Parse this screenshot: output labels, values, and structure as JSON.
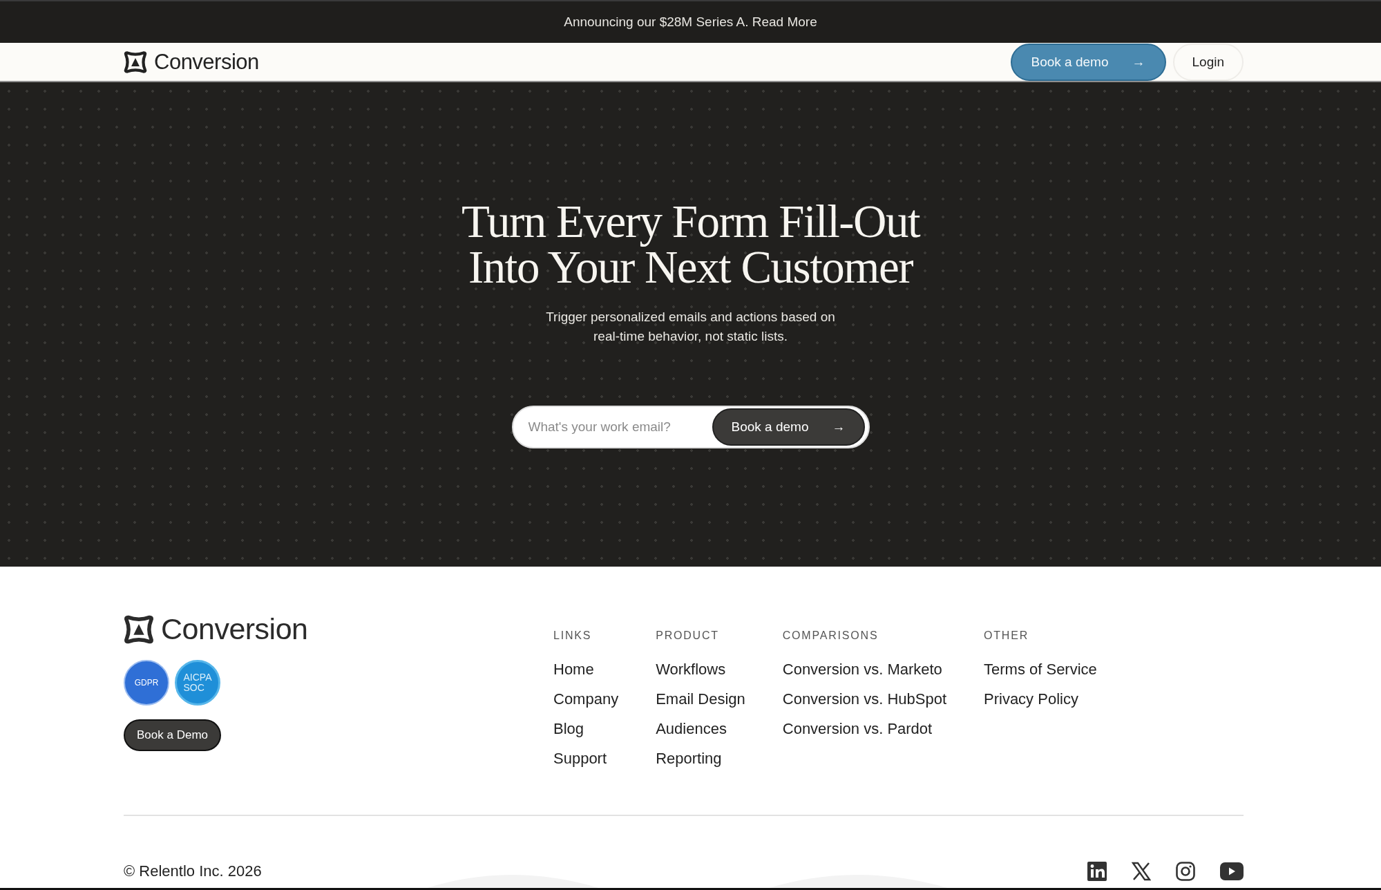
{
  "announcement": "Announcing our $28M Series A. Read More",
  "nav": {
    "brand": "Conversion",
    "buttons": [
      {
        "label": "Book a demo",
        "kind": "primary",
        "arrow": "→"
      },
      {
        "label": "Login",
        "kind": "outline"
      }
    ]
  },
  "hero": {
    "title_lines": [
      "Turn Every Form Fill-Out",
      "Into Your Next Customer"
    ],
    "subtitle_lines": [
      "Trigger personalized emails and actions based on",
      "real-time behavior, not static lists."
    ],
    "email": {
      "placeholder": "What's your work email?"
    },
    "button": {
      "label": "Book a demo",
      "arrow": "→"
    }
  },
  "footer": {
    "brand": "Conversion",
    "badges": [
      {
        "lines": [
          "GDPR"
        ],
        "kind": "gdpr"
      },
      {
        "lines": [
          "AICPA",
          "SOC"
        ],
        "kind": "soc"
      }
    ],
    "button": "Book a Demo",
    "columns": [
      {
        "heading": "LINKS",
        "links": [
          "Home",
          "Company",
          "Blog",
          "Support"
        ]
      },
      {
        "heading": "PRODUCT",
        "links": [
          "Workflows",
          "Email Design",
          "Audiences",
          "Reporting"
        ]
      },
      {
        "heading": "COMPARISONS",
        "links": [
          "Conversion vs. Marketo",
          "Conversion vs. HubSpot",
          "Conversion vs. Pardot"
        ]
      },
      {
        "heading": "OTHER",
        "links": [
          "Terms of Service",
          "Privacy Policy"
        ]
      }
    ],
    "copyright": "© Relentlo Inc. 2026",
    "socials": [
      {
        "kind": "linkedin"
      },
      {
        "kind": "x"
      },
      {
        "kind": "instagram"
      },
      {
        "kind": "youtube"
      }
    ]
  }
}
